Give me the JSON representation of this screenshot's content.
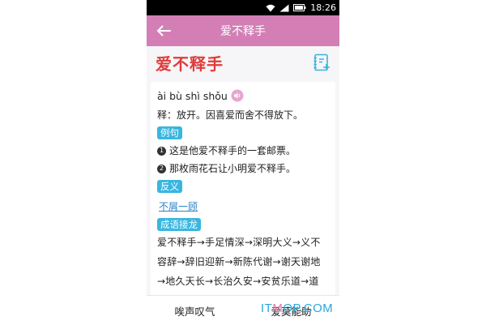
{
  "status_bar": {
    "time": "18:26"
  },
  "appbar": {
    "title": "爱不释手"
  },
  "idiom": {
    "title": "爱不释手",
    "pinyin": "ài bù shì shǒu",
    "meaning": "释：放开。因喜爱而舍不得放下。",
    "examples_label": "例句",
    "examples": [
      {
        "num": "1",
        "text": "这是他爱不释手的一套邮票。"
      },
      {
        "num": "2",
        "text": "那枚雨花石让小明爱不释手。"
      }
    ],
    "antonym_label": "反义",
    "antonym": "不屑一顾",
    "chain_label": "成语接龙",
    "chain_lines": [
      "爱不释手→手足情深→深明大义→义不",
      "容辞→辞旧迎新→新陈代谢→谢天谢地",
      "→地久天长→长治久安→安贫乐道→道"
    ]
  },
  "bottom_bar": {
    "prev": "唉声叹气",
    "next": "爱莫能助"
  },
  "watermark": {
    "text_a": "IT",
    "text_dot": "M",
    "text_b": "OP.COM"
  },
  "colors": {
    "appbar": "#d37fb6",
    "title": "#e03b3b",
    "tag": "#38b6df",
    "link": "#2b84c9"
  }
}
